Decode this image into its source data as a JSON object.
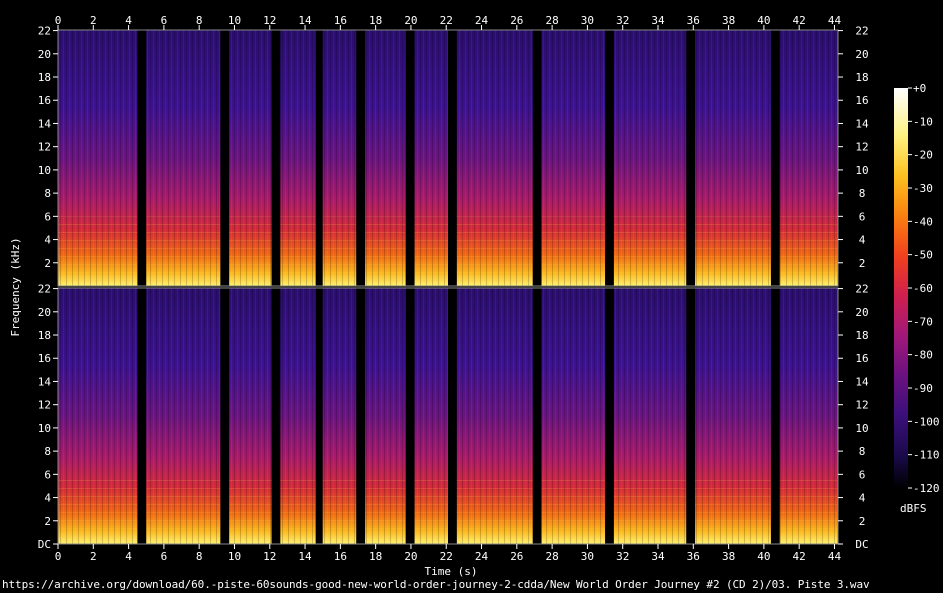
{
  "chart_data": {
    "type": "heatmap",
    "subtype": "spectrogram",
    "channels": 2,
    "xlabel": "Time (s)",
    "ylabel": "Frequency (kHz)",
    "xlim": [
      0,
      44.2
    ],
    "ylim": [
      0,
      22.05
    ],
    "x_ticks": [
      0,
      2,
      4,
      6,
      8,
      10,
      12,
      14,
      16,
      18,
      20,
      22,
      24,
      26,
      28,
      30,
      32,
      34,
      36,
      38,
      40,
      42,
      44
    ],
    "y_ticks": [
      {
        "value": 0,
        "label": "DC"
      },
      {
        "value": 2,
        "label": "2"
      },
      {
        "value": 4,
        "label": "4"
      },
      {
        "value": 6,
        "label": "6"
      },
      {
        "value": 8,
        "label": "8"
      },
      {
        "value": 10,
        "label": "10"
      },
      {
        "value": 12,
        "label": "12"
      },
      {
        "value": 14,
        "label": "14"
      },
      {
        "value": 16,
        "label": "16"
      },
      {
        "value": 18,
        "label": "18"
      },
      {
        "value": 20,
        "label": "20"
      },
      {
        "value": 22,
        "label": "22"
      }
    ],
    "colorbar": {
      "unit_label": "dBFS",
      "range": [
        -120,
        0
      ],
      "ticks": [
        "+0",
        "-10",
        "-20",
        "-30",
        "-40",
        "-50",
        "-60",
        "-70",
        "-80",
        "-90",
        "-100",
        "-110",
        "-120"
      ],
      "colormap": [
        "#000000",
        "#1a0a4a",
        "#3a0f7a",
        "#6a1180",
        "#a0187a",
        "#d01f4e",
        "#f0401e",
        "#fa8010",
        "#fdc020",
        "#fff080",
        "#ffffff"
      ]
    },
    "silent_gaps_s": [
      [
        4.5,
        5.0
      ],
      [
        9.2,
        9.7
      ],
      [
        12.1,
        12.6
      ],
      [
        14.6,
        15.0
      ],
      [
        16.9,
        17.4
      ],
      [
        19.7,
        20.2
      ],
      [
        22.1,
        22.6
      ],
      [
        26.9,
        27.4
      ],
      [
        31.0,
        31.5
      ],
      [
        35.6,
        36.1
      ],
      [
        40.4,
        40.9
      ]
    ],
    "grid": false,
    "legend": "right"
  },
  "footer": {
    "source_url": "https://archive.org/download/60.-piste-60sounds-good-new-world-order-journey-2-cdda/New World Order Journey #2 (CD 2)/03. Piste 3.wav"
  }
}
